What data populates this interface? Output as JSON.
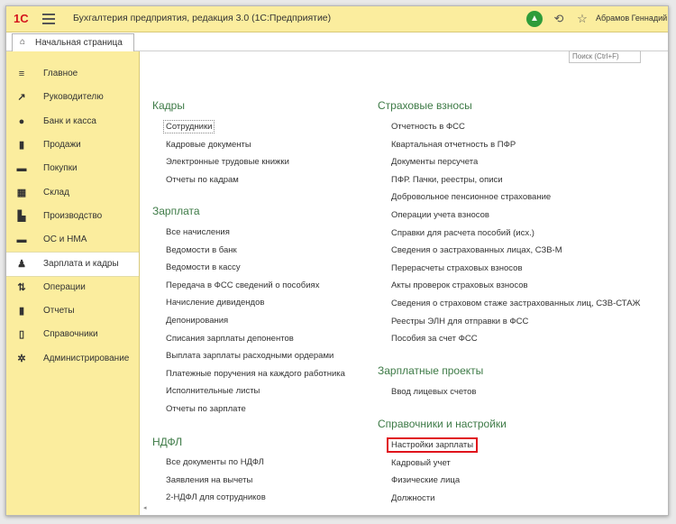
{
  "app": {
    "logo_text": "1С",
    "title": "Бухгалтерия предприятия, редакция 3.0  (1С:Предприятие)",
    "user_name": "Абрамов Геннадий"
  },
  "tabs": {
    "home": "Начальная страница"
  },
  "search": {
    "placeholder": "Поиск (Ctrl+F)"
  },
  "sidebar": {
    "items": [
      {
        "label": "Главное",
        "icon": "list-icon"
      },
      {
        "label": "Руководителю",
        "icon": "trend-icon"
      },
      {
        "label": "Банк и касса",
        "icon": "coin-icon"
      },
      {
        "label": "Продажи",
        "icon": "bag-icon"
      },
      {
        "label": "Покупки",
        "icon": "cart-icon"
      },
      {
        "label": "Склад",
        "icon": "warehouse-icon"
      },
      {
        "label": "Производство",
        "icon": "factory-icon"
      },
      {
        "label": "ОС и НМА",
        "icon": "truck-icon"
      },
      {
        "label": "Зарплата и кадры",
        "icon": "person-icon"
      },
      {
        "label": "Операции",
        "icon": "operations-icon"
      },
      {
        "label": "Отчеты",
        "icon": "bar-chart-icon"
      },
      {
        "label": "Справочники",
        "icon": "book-icon"
      },
      {
        "label": "Администрирование",
        "icon": "gear-icon"
      }
    ],
    "active_index": 8
  },
  "sections": {
    "kadry": {
      "title": "Кадры",
      "links": [
        "Сотрудники",
        "Кадровые документы",
        "Электронные трудовые книжки",
        "Отчеты по кадрам"
      ]
    },
    "zarplata": {
      "title": "Зарплата",
      "links": [
        "Все начисления",
        "Ведомости в банк",
        "Ведомости в кассу",
        "Передача в ФСС сведений о пособиях",
        "Начисление дивидендов",
        "Депонирования",
        "Списания зарплаты депонентов",
        "Выплата зарплаты расходными ордерами",
        "Платежные поручения на каждого работника",
        "Исполнительные листы",
        "Отчеты по зарплате"
      ]
    },
    "ndfl": {
      "title": "НДФЛ",
      "links": [
        "Все документы по НДФЛ",
        "Заявления на вычеты",
        "2-НДФЛ для сотрудников"
      ]
    },
    "vznosy": {
      "title": "Страховые взносы",
      "links": [
        "Отчетность в ФСС",
        "Квартальная отчетность в ПФР",
        "Документы персучета",
        "ПФР. Пачки, реестры, описи",
        "Добровольное пенсионное страхование",
        "Операции учета взносов",
        "Справки для расчета пособий (исх.)",
        "Сведения о застрахованных лицах, СЗВ-М",
        "Перерасчеты страховых взносов",
        "Акты проверок страховых взносов",
        "Сведения о страховом стаже застрахованных лиц, СЗВ-СТАЖ",
        "Реестры ЭЛН для отправки в ФСС",
        "Пособия за счет ФСС"
      ]
    },
    "proekty": {
      "title": "Зарплатные проекты",
      "links": [
        "Ввод лицевых счетов"
      ]
    },
    "spravochniki": {
      "title": "Справочники и настройки",
      "links": [
        "Настройки зарплаты",
        "Кадровый учет",
        "Физические лица",
        "Должности"
      ]
    }
  },
  "colors": {
    "header_bg": "#fbed9e",
    "section_title": "#3d7a46",
    "highlight": "#e0141c",
    "bell": "#2e9c3a"
  }
}
